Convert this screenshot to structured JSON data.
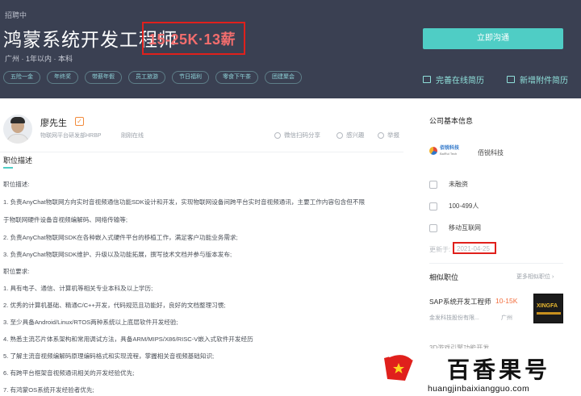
{
  "job": {
    "status": "招聘中",
    "title": "鸿蒙系统开发工程师",
    "salary": "15-25K·13薪",
    "meta": "广州 · 1年以内 · 本科",
    "tags": [
      "五险一金",
      "年终奖",
      "带薪年假",
      "员工旅游",
      "节日福利",
      "零食下午茶",
      "团建聚会"
    ],
    "apply_label": "立即沟通",
    "complete_resume_label": "完善在线简历",
    "add_attachment_label": "新增附件简历"
  },
  "recruiter": {
    "name": "廖先生",
    "role": "物联网平台研发部HRBP",
    "online": "刚刚在线",
    "actions": [
      "微信扫码分享",
      "感兴趣",
      "举报"
    ]
  },
  "description": {
    "section_title": "职位描述",
    "lines": [
      "职位描述:",
      "1. 负责AnyChat物联网方向实时音视频通信功能SDK设计和开发，实现物联网设备间跨平台实时音视频通讯，主要工作内容包含但不限",
      "于物联网硬件设备音视频编解码、网络传输等;",
      "2. 负责AnyChat物联网SDK在各种嵌入式硬件平台的移植工作，满足客户功能业务需求;",
      "3. 负责AnyChat物联网SDK维护、升级以及功能拓展，撰写技术文档并参与版本发布;",
      "职位要求:",
      "1. 具有电子、通信、计算机等相关专业本科及以上学历;",
      "2. 优秀的计算机基础、精通C/C++开发，代码规范且功能好，良好的文档整理习惯;",
      "3. 至少具备Android/Linux/RTOS两种系统以上底层软件开发经验;",
      "4. 熟悉主流芯片体系架构和常用调试方法，具备ARM/MIPS/X86/RISC-V嵌入式软件开发经历",
      "5. 了解主流音视频编解码原理编码格式和实现流程，掌握相关音视频基础知识;",
      "6. 有跨平台框架音视频通讯相关的开发经验优先;",
      "7. 有鸿蒙OS系统开发经验者优先;"
    ]
  },
  "company": {
    "section_title": "公司基本信息",
    "logo_text": "佰锐科技",
    "logo_sub": "BaiRui Tech",
    "name": "佰锐科技",
    "funding": "未融资",
    "size": "100-499人",
    "industry": "移动互联网",
    "updated_label": "更新于:",
    "updated_date": "2021-04-25"
  },
  "similar": {
    "section_title": "相似职位",
    "more_label": "更多相似职位",
    "job_title": "SAP系统开发工程师",
    "job_salary": "10-15K",
    "job_company": "金发科技股份有限...",
    "job_location": "广州",
    "logo_text": "XINGFA",
    "next_job_partial": "3D游戏引擎功能开发"
  },
  "watermark": {
    "brand": "百香果号",
    "url": "huangjinbaixiangguo.com"
  },
  "colors": {
    "header_bg": "#3a4052",
    "accent": "#4fcdc5",
    "salary": "#f26d6d",
    "highlight_box": "#e0201c"
  }
}
